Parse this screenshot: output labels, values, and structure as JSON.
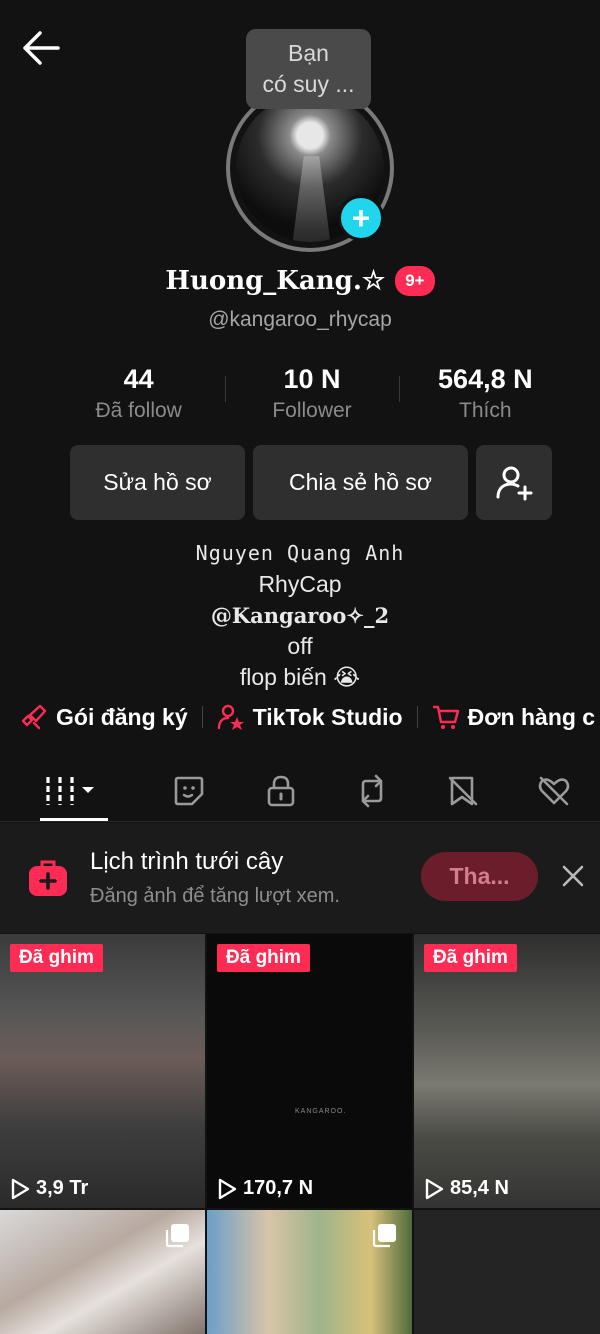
{
  "tooltip": {
    "line1": "Bạn",
    "line2": "có suy ..."
  },
  "profile": {
    "display_name": "Huong_Kang.☆",
    "notification_badge": "9+",
    "username": "@kangaroo_rhycap"
  },
  "stats": [
    {
      "value": "44",
      "label": "Đã follow"
    },
    {
      "value": "10 N",
      "label": "Follower"
    },
    {
      "value": "564,8 N",
      "label": "Thích"
    }
  ],
  "buttons": {
    "edit": "Sửa hồ sơ",
    "share": "Chia sẻ hồ sơ"
  },
  "bio": {
    "line1": "Nguyen Quang Anh",
    "line2": "RhyCap",
    "line3": "@Kangaroo✧_2",
    "line4": "off",
    "line5": "flop biến 😭"
  },
  "links": [
    {
      "label": "Gói đăng ký",
      "icon": "subscription-icon"
    },
    {
      "label": "TikTok Studio",
      "icon": "studio-icon"
    },
    {
      "label": "Đơn hàng c",
      "icon": "cart-icon"
    }
  ],
  "tabs": [
    {
      "icon": "videos-grid-icon"
    },
    {
      "icon": "stickers-icon"
    },
    {
      "icon": "lock-icon"
    },
    {
      "icon": "repost-icon"
    },
    {
      "icon": "favorites-hidden-icon"
    },
    {
      "icon": "liked-hidden-icon"
    }
  ],
  "banner": {
    "title": "Lịch trình tưới cây",
    "subtitle": "Đăng ảnh để tăng lượt xem.",
    "cta": "Tha..."
  },
  "videos": [
    {
      "pinned": "Đã ghim",
      "views": "3,9 Tr"
    },
    {
      "pinned": "Đã ghim",
      "views": "170,7 N",
      "caption": "KANGAROO."
    },
    {
      "pinned": "Đã ghim",
      "views": "85,4 N"
    }
  ],
  "colors": {
    "accent": "#fe2c55",
    "plus": "#20d5ec",
    "background": "#121212"
  }
}
